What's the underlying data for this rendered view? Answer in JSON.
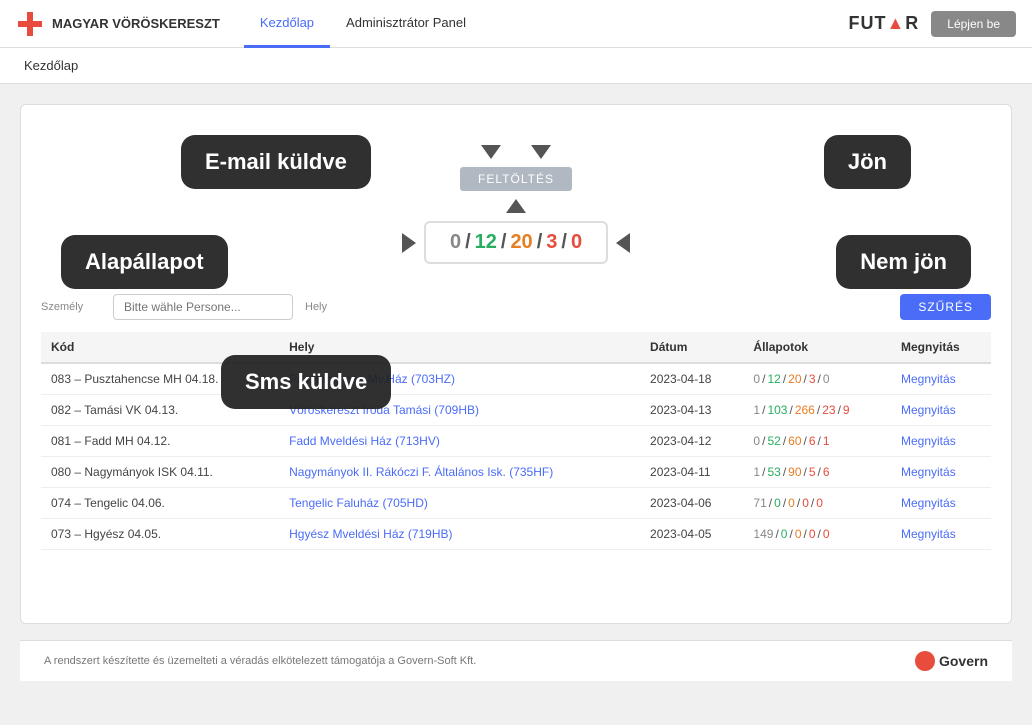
{
  "header": {
    "logo_text": "MAGYAR VÖRÖSKERESZT",
    "nav": [
      {
        "label": "Kezdőlap",
        "active": true
      },
      {
        "label": "Adminisztrátor Panel",
        "active": false
      }
    ],
    "futar": "FUT▲R",
    "login_label": "Lépjen be"
  },
  "breadcrumb": "Kezdőlap",
  "callouts": {
    "email_kuldve": "E-mail küldve",
    "jon": "Jön",
    "alapallapot": "Alapállapot",
    "nem_jon": "Nem jön",
    "sms_kuldve": "Sms küldve"
  },
  "upload": {
    "label": "FELTÖLTÉS"
  },
  "counter": {
    "values": [
      {
        "val": "0",
        "class": "s-gray"
      },
      {
        "sep": " / "
      },
      {
        "val": "12",
        "class": "s-green"
      },
      {
        "sep": " / "
      },
      {
        "val": "20",
        "class": "s-orange"
      },
      {
        "sep": " / "
      },
      {
        "val": "3",
        "class": "s-red"
      },
      {
        "sep": " / "
      },
      {
        "val": "0",
        "class": "s-red"
      }
    ]
  },
  "filter": {
    "szemely_label": "Személy",
    "hely_label": "Hely",
    "szemely_placeholder": "Bitte wähle Persone...",
    "szures_label": "SZŰRÉS"
  },
  "table": {
    "columns": [
      "Kód",
      "Hely",
      "Dátum",
      "Állapotok",
      "Megnyitás"
    ],
    "rows": [
      {
        "kod": "083 – Pusztahencse MH 04.18.",
        "hely": "Pusztahencse Mv.Ház (703HZ)",
        "datum": "2023-04-18",
        "allapot": "0 / 12 / 20 / 3 / 0",
        "allapot_parts": [
          {
            "v": "0",
            "c": "s-gray"
          },
          {
            "s": " / "
          },
          {
            "v": "12",
            "c": "s-green"
          },
          {
            "s": " / "
          },
          {
            "v": "20",
            "c": "s-orange"
          },
          {
            "s": " / "
          },
          {
            "v": "3",
            "c": "s-red"
          },
          {
            "s": " / "
          },
          {
            "v": "0",
            "c": "s-gray"
          }
        ],
        "megnyitas": "Megnyitás"
      },
      {
        "kod": "082 – Tamási VK 04.13.",
        "hely": "Vöröskereszt Iroda Tamási (709HB)",
        "datum": "2023-04-13",
        "allapot": "1 / 103 / 266 / 23 / 9",
        "allapot_parts": [
          {
            "v": "1",
            "c": "s-gray"
          },
          {
            "s": " / "
          },
          {
            "v": "103",
            "c": "s-green"
          },
          {
            "s": " / "
          },
          {
            "v": "266",
            "c": "s-orange"
          },
          {
            "s": " / "
          },
          {
            "v": "23",
            "c": "s-red"
          },
          {
            "s": " / "
          },
          {
            "v": "9",
            "c": "s-red"
          }
        ],
        "megnyitas": "Megnyitás"
      },
      {
        "kod": "081 – Fadd MH 04.12.",
        "hely": "Fadd Mveldési Ház (713HV)",
        "datum": "2023-04-12",
        "allapot": "0 / 52 / 60 / 6 / 1",
        "allapot_parts": [
          {
            "v": "0",
            "c": "s-gray"
          },
          {
            "s": " / "
          },
          {
            "v": "52",
            "c": "s-green"
          },
          {
            "s": " / "
          },
          {
            "v": "60",
            "c": "s-orange"
          },
          {
            "s": " / "
          },
          {
            "v": "6",
            "c": "s-red"
          },
          {
            "s": " / "
          },
          {
            "v": "1",
            "c": "s-red"
          }
        ],
        "megnyitas": "Megnyitás"
      },
      {
        "kod": "080 – Nagymányok ISK 04.11.",
        "hely": "Nagymányok II. Rákóczi F. Általános Isk. (735HF)",
        "datum": "2023-04-11",
        "allapot": "1 / 53 / 90 / 5 / 6",
        "allapot_parts": [
          {
            "v": "1",
            "c": "s-gray"
          },
          {
            "s": " / "
          },
          {
            "v": "53",
            "c": "s-green"
          },
          {
            "s": " / "
          },
          {
            "v": "90",
            "c": "s-orange"
          },
          {
            "s": " / "
          },
          {
            "v": "5",
            "c": "s-red"
          },
          {
            "s": " / "
          },
          {
            "v": "6",
            "c": "s-red"
          }
        ],
        "megnyitas": "Megnyitás"
      },
      {
        "kod": "074 – Tengelic 04.06.",
        "hely": "Tengelic Faluház (705HD)",
        "datum": "2023-04-06",
        "allapot": "71 / 0 / 0 / 0 / 0",
        "allapot_parts": [
          {
            "v": "71",
            "c": "s-gray"
          },
          {
            "s": " / "
          },
          {
            "v": "0",
            "c": "s-green"
          },
          {
            "s": " / "
          },
          {
            "v": "0",
            "c": "s-orange"
          },
          {
            "s": " / "
          },
          {
            "v": "0",
            "c": "s-red"
          },
          {
            "s": " / "
          },
          {
            "v": "0",
            "c": "s-red"
          }
        ],
        "megnyitas": "Megnyitás"
      },
      {
        "kod": "073 – Hgyész 04.05.",
        "hely": "Hgyész Mveldési Ház (719HB)",
        "datum": "2023-04-05",
        "allapot": "149 / 0 / 0 / 0 / 0",
        "allapot_parts": [
          {
            "v": "149",
            "c": "s-gray"
          },
          {
            "s": " / "
          },
          {
            "v": "0",
            "c": "s-green"
          },
          {
            "s": " / "
          },
          {
            "v": "0",
            "c": "s-orange"
          },
          {
            "s": " / "
          },
          {
            "v": "0",
            "c": "s-red"
          },
          {
            "s": " / "
          },
          {
            "v": "0",
            "c": "s-red"
          }
        ],
        "megnyitas": "Megnyitás"
      }
    ]
  },
  "footer": {
    "text": "A rendszert készítette és üzemelteti a véradás elkötelezett támogatója a Govern-Soft Kft.",
    "brand": "Govern"
  }
}
